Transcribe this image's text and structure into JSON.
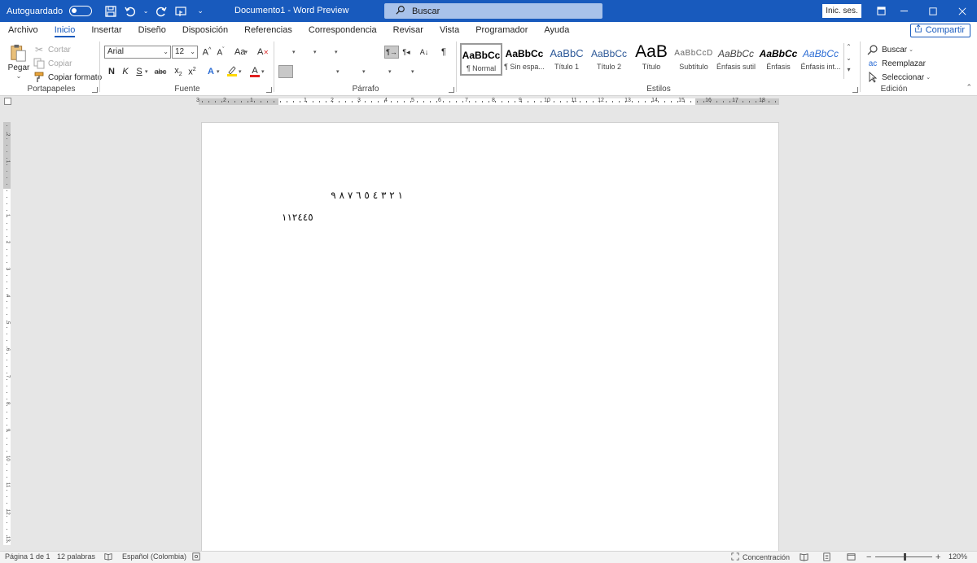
{
  "titlebar": {
    "autosave_label": "Autoguardado",
    "document_title": "Documento1 - Word Preview",
    "search_placeholder": "Buscar",
    "signin_label": "Inic. ses.",
    "bg_color": "#185abd"
  },
  "tabs": [
    "Archivo",
    "Inicio",
    "Insertar",
    "Diseño",
    "Disposición",
    "Referencias",
    "Correspondencia",
    "Revisar",
    "Vista",
    "Programador",
    "Ayuda"
  ],
  "active_tab": "Inicio",
  "share_label": "Compartir",
  "clipboard": {
    "paste": "Pegar",
    "cut": "Cortar",
    "copy": "Copiar",
    "format_painter": "Copiar formato",
    "label": "Portapapeles"
  },
  "font": {
    "name": "Arial",
    "size": "12",
    "label": "Fuente",
    "bold": "N",
    "italic": "K",
    "underline": "S",
    "strike": "abc",
    "highlight_color": "#ffd800",
    "font_color": "#e02020"
  },
  "paragraph": {
    "label": "Párrafo"
  },
  "styles": {
    "label": "Estilos",
    "items": [
      {
        "preview": "AaBbCc",
        "name": "¶ Normal"
      },
      {
        "preview": "AaBbCc",
        "name": "¶ Sin espa..."
      },
      {
        "preview": "AaBbC",
        "name": "Título 1"
      },
      {
        "preview": "AaBbCc",
        "name": "Título 2"
      },
      {
        "preview": "AaB",
        "name": "Título"
      },
      {
        "preview": "AaBbCcD",
        "name": "Subtítulo"
      },
      {
        "preview": "AaBbCc",
        "name": "Énfasis sutil"
      },
      {
        "preview": "AaBbCc",
        "name": "Énfasis"
      },
      {
        "preview": "AaBbCc",
        "name": "Énfasis int..."
      }
    ]
  },
  "editing": {
    "label": "Edición",
    "find": "Buscar",
    "replace": "Reemplazar",
    "select": "Seleccionar"
  },
  "ruler": {
    "h_numbers": [
      "3",
      "2",
      "1",
      "1",
      "2",
      "3",
      "4",
      "5",
      "6",
      "7",
      "8",
      "9",
      "10",
      "11",
      "12",
      "13",
      "14",
      "15",
      "16",
      "17",
      "18"
    ],
    "v_numbers": [
      "2",
      "1",
      "1",
      "2",
      "3",
      "4",
      "5",
      "6",
      "7",
      "8",
      "9",
      "10",
      "11",
      "12",
      "13"
    ]
  },
  "document": {
    "lines": [
      "١ ٢ ٣ ٤ ٥ ٦ ٧ ٨ ٩",
      "١١٢٤٤٥"
    ]
  },
  "status": {
    "page": "Página 1 de 1",
    "words": "12 palabras",
    "language": "Español (Colombia)",
    "focus": "Concentración",
    "zoom": "120%"
  }
}
